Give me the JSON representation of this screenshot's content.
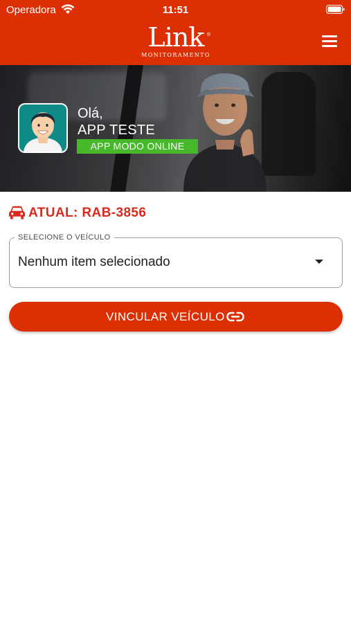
{
  "status_bar": {
    "carrier": "Operadora",
    "time": "11:51",
    "icons": [
      "wifi-icon",
      "battery-icon"
    ]
  },
  "header": {
    "logo_text": "Link",
    "logo_subtext": "MONITORAMENTO",
    "logo_registered": "®",
    "menu_icon": "hamburger-menu-icon"
  },
  "banner": {
    "greeting": "Olá,",
    "user_name": "APP TESTE",
    "mode_badge": "APP MODO ONLINE",
    "avatar_icon": "user-avatar-icon"
  },
  "current_vehicle": {
    "label": "ATUAL: RAB-3856",
    "icon": "car-icon"
  },
  "vehicle_select": {
    "legend": "SELECIONE O VEÍCULO",
    "value": "Nenhum item selecionado",
    "icon": "dropdown-arrow-icon"
  },
  "link_button": {
    "label": "VINCULAR VEÍCULO",
    "icon": "link-icon"
  },
  "colors": {
    "brand_red": "#dc2f04",
    "vehicle_text_red": "#d92a1c",
    "online_green": "#47b82c",
    "avatar_teal": "#0f8a87"
  }
}
